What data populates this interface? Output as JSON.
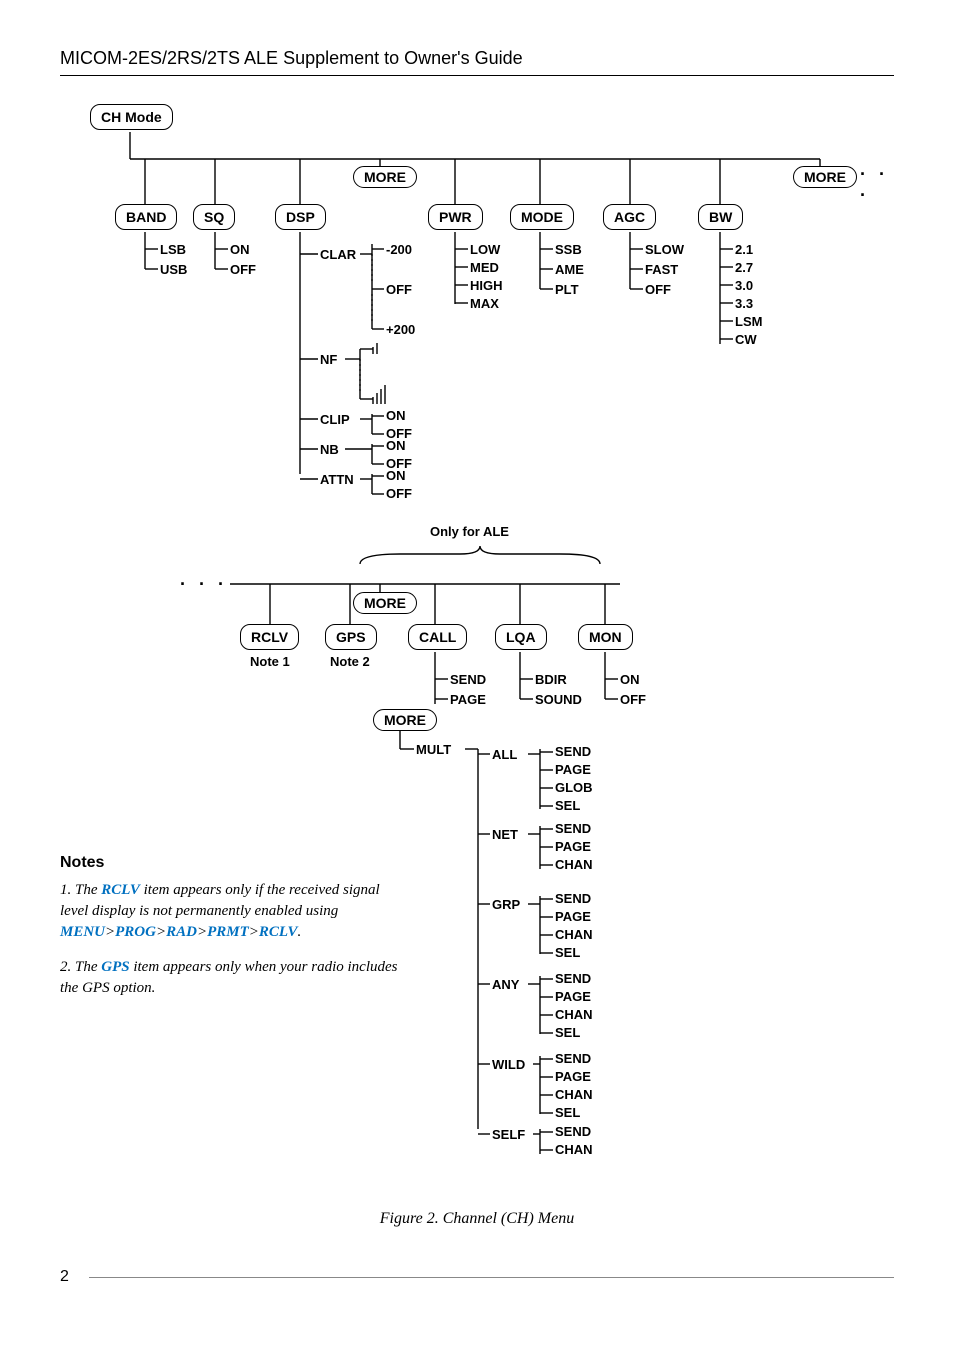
{
  "header": "MICOM-2ES/2RS/2TS ALE Supplement to Owner's Guide",
  "root": "CH Mode",
  "more": "MORE",
  "top_menus": {
    "band": {
      "label": "BAND",
      "items": [
        "LSB",
        "USB"
      ]
    },
    "sq": {
      "label": "SQ",
      "items": [
        "ON",
        "OFF"
      ]
    },
    "dsp": {
      "label": "DSP",
      "clar": {
        "label": "CLAR",
        "lo": "-200",
        "off": "OFF",
        "hi": "+200"
      },
      "nf": {
        "label": "NF"
      },
      "clip": {
        "label": "CLIP",
        "on": "ON",
        "off": "OFF"
      },
      "nb": {
        "label": "NB",
        "on": "ON",
        "off": "OFF"
      },
      "attn": {
        "label": "ATTN",
        "on": "ON",
        "off": "OFF"
      }
    },
    "pwr": {
      "label": "PWR",
      "items": [
        "LOW",
        "MED",
        "HIGH",
        "MAX"
      ]
    },
    "mode": {
      "label": "MODE",
      "items": [
        "SSB",
        "AME",
        "PLT"
      ]
    },
    "agc": {
      "label": "AGC",
      "items": [
        "SLOW",
        "FAST",
        "OFF"
      ]
    },
    "bw": {
      "label": "BW",
      "items": [
        "2.1",
        "2.7",
        "3.0",
        "3.3",
        "LSM",
        "CW"
      ]
    }
  },
  "ale_heading": "Only for ALE",
  "ale_menus": {
    "rclv": {
      "label": "RCLV",
      "note": "Note 1"
    },
    "gps": {
      "label": "GPS",
      "note": "Note 2"
    },
    "call": {
      "label": "CALL",
      "send": "SEND",
      "page": "PAGE"
    },
    "lqa": {
      "label": "LQA",
      "bdir": "BDIR",
      "sound": "SOUND"
    },
    "mon": {
      "label": "MON",
      "on": "ON",
      "off": "OFF"
    }
  },
  "mult": {
    "label": "MULT",
    "all": {
      "label": "ALL",
      "items": [
        "SEND",
        "PAGE",
        "GLOB",
        "SEL"
      ]
    },
    "net": {
      "label": "NET",
      "items": [
        "SEND",
        "PAGE",
        "CHAN"
      ]
    },
    "grp": {
      "label": "GRP",
      "items": [
        "SEND",
        "PAGE",
        "CHAN",
        "SEL"
      ]
    },
    "any": {
      "label": "ANY",
      "items": [
        "SEND",
        "PAGE",
        "CHAN",
        "SEL"
      ]
    },
    "wild": {
      "label": "WILD",
      "items": [
        "SEND",
        "PAGE",
        "CHAN",
        "SEL"
      ]
    },
    "self": {
      "label": "SELF",
      "items": [
        "SEND",
        "CHAN"
      ]
    }
  },
  "notes": {
    "heading": "Notes",
    "n1_a": "1. The ",
    "n1_kw": "RCLV",
    "n1_b": " item appears only if the received signal level display is not permanently enabled using ",
    "n1_path_menu": "MENU",
    "n1_path_prog": "PROG",
    "n1_path_rad": "RAD",
    "n1_path_prmt": "PRMT",
    "n1_path_rclv": "RCLV",
    "n2_a": "2. The ",
    "n2_kw": "GPS",
    "n2_b": " item appears only when your radio includes the GPS option."
  },
  "caption": "Figure 2. Channel (CH) Menu",
  "page": "2"
}
